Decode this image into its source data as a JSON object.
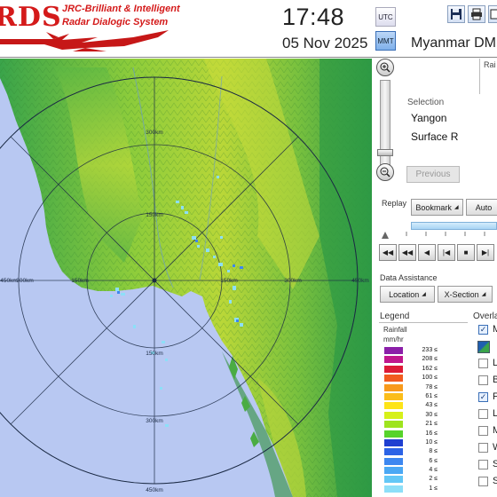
{
  "logo": {
    "wordmark": "RDS",
    "line1": "JRC-Brilliant & Intelligent",
    "line2": "Radar Dialogic System"
  },
  "clock": {
    "time": "17:48",
    "date": "05 Nov 2025"
  },
  "timezone": {
    "utc": "UTC",
    "mmt": "MMT"
  },
  "toolbar": {
    "save_icon": "save-icon",
    "print_icon": "print-icon",
    "export_icon": "export-icon"
  },
  "panel": {
    "title": "Myanmar DM",
    "rain_cut": "Rai"
  },
  "selection": {
    "heading": "Selection",
    "station": "Yangon",
    "product": "Surface R",
    "previous": "Previous"
  },
  "replay": {
    "label": "Replay",
    "bookmark": "Bookmark",
    "auto": "Auto"
  },
  "assist": {
    "label": "Data Assistance",
    "location": "Location",
    "xsection": "X-Section"
  },
  "map": {
    "range_labels": [
      "300km",
      "150km",
      "150km",
      "300km",
      "450km",
      "450km",
      "300km",
      "150km",
      "150km",
      "300km",
      "450km"
    ]
  },
  "legend": {
    "heading": "Legend",
    "title": "Rainfall",
    "unit": "mm/hr",
    "rows": [
      {
        "label": "233 ≤",
        "color": "#8b1fa9"
      },
      {
        "label": "208 ≤",
        "color": "#c0178d"
      },
      {
        "label": "162 ≤",
        "color": "#dd1a37"
      },
      {
        "label": "100 ≤",
        "color": "#f15b1f"
      },
      {
        "label": "78 ≤",
        "color": "#f89a1c"
      },
      {
        "label": "61 ≤",
        "color": "#fbbd1a"
      },
      {
        "label": "43 ≤",
        "color": "#fde418"
      },
      {
        "label": "30 ≤",
        "color": "#d6f01a"
      },
      {
        "label": "21 ≤",
        "color": "#9ee41f"
      },
      {
        "label": "16 ≤",
        "color": "#57d32b"
      },
      {
        "label": "10 ≤",
        "color": "#1f3fd1"
      },
      {
        "label": "8 ≤",
        "color": "#2c63e6"
      },
      {
        "label": "6 ≤",
        "color": "#3d87f0"
      },
      {
        "label": "4 ≤",
        "color": "#4aa8f4"
      },
      {
        "label": "2 ≤",
        "color": "#63c7f6"
      },
      {
        "label": "1 ≤",
        "color": "#8ddff8"
      }
    ]
  },
  "overlay": {
    "heading": "Overla",
    "items": [
      {
        "label": "M",
        "checked": true
      },
      {
        "label": "",
        "checked": false,
        "swatch": true
      },
      {
        "label": "L",
        "checked": false
      },
      {
        "label": "B",
        "checked": false
      },
      {
        "label": "F",
        "checked": true
      },
      {
        "label": "L",
        "checked": false
      },
      {
        "label": "M",
        "checked": false
      },
      {
        "label": "W",
        "checked": false
      },
      {
        "label": "S",
        "checked": false
      },
      {
        "label": "S",
        "checked": false
      }
    ]
  }
}
